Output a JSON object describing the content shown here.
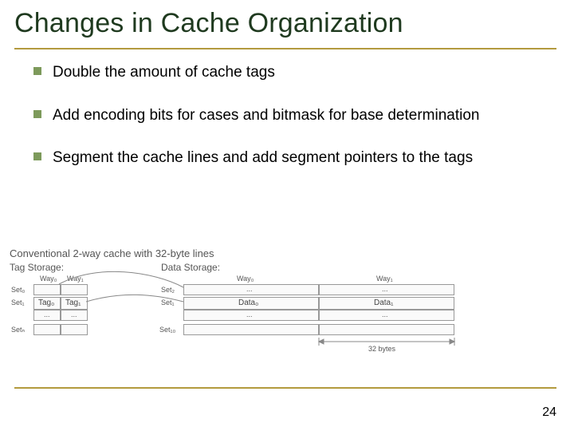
{
  "title": "Changes in Cache Organization",
  "bullets": [
    "Double the amount of cache tags",
    "Add encoding bits for cases and bitmask for base determination",
    "Segment the cache lines and add segment pointers to the tags"
  ],
  "diagram": {
    "heading": "Conventional 2-way cache with 32-byte lines",
    "tag_label": "Tag Storage:",
    "data_label": "Data Storage:",
    "way0": "Way₀",
    "way1": "Way₁",
    "set0": "Set₀",
    "set1": "Set₁",
    "setN": "Setₙ",
    "set2": "Set₂",
    "set10": "Set₁₀",
    "tag0": "Tag₀",
    "tag1": "Tag₁",
    "data0": "Data₀",
    "data1": "Data₁",
    "ellipsis": "...",
    "bytes": "32 bytes"
  },
  "page_number": "24"
}
